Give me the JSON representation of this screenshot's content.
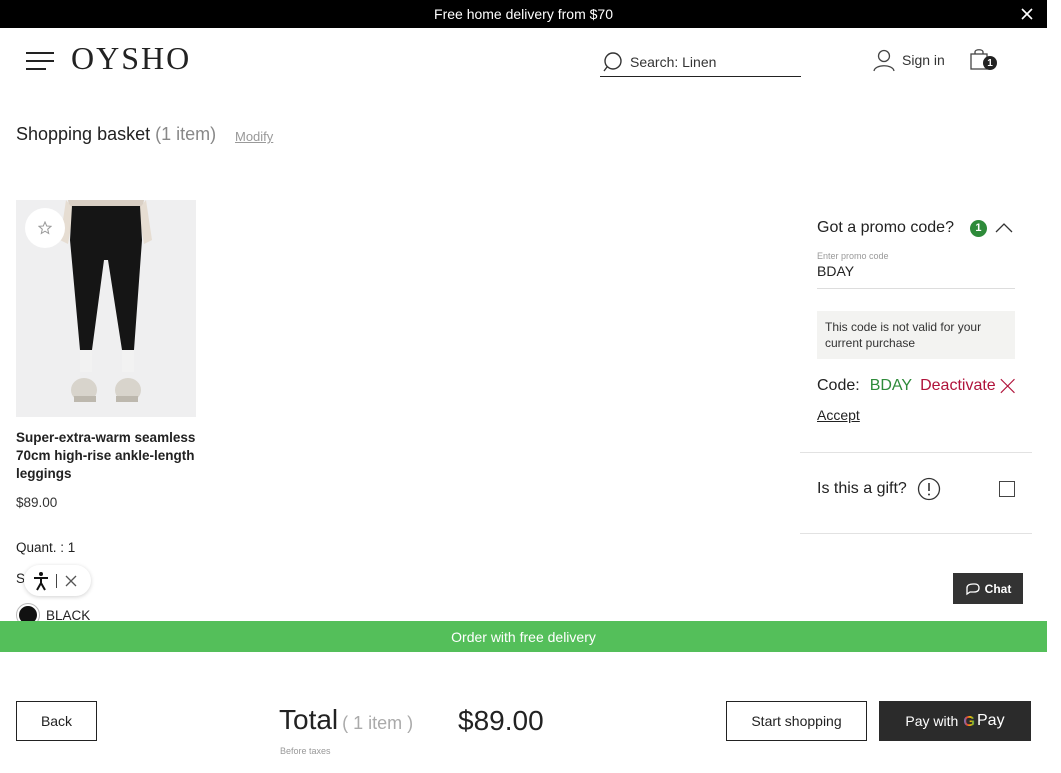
{
  "banner": {
    "text": "Free home delivery from $70"
  },
  "header": {
    "logo": "OYSHO",
    "search_text": "Search: Linen",
    "signin_label": "Sign in",
    "bag_count": "1"
  },
  "basket": {
    "title": "Shopping basket",
    "count_text": "(1 item)",
    "modify_label": "Modify"
  },
  "product": {
    "name": "Super-extra-warm seamless 70cm high-rise ankle-length leggings",
    "price": "$89.00",
    "quantity": "Quant. : 1",
    "size_label": "S",
    "color": "BLACK"
  },
  "promo": {
    "heading": "Got a promo code?",
    "badge": "1",
    "field_label": "Enter promo code",
    "field_value": "BDAY",
    "error": "This code is not valid for your current purchase",
    "code_label": "Code:",
    "code_value": "BDAY",
    "deactivate_label": "Deactivate",
    "accept_label": "Accept"
  },
  "gift": {
    "label": "Is this a gift?"
  },
  "chat": {
    "label": "Chat"
  },
  "free_delivery": {
    "text": "Order with free delivery"
  },
  "footer": {
    "back_label": "Back",
    "total_label": "Total",
    "total_items": "( 1 item )",
    "total_price": "$89.00",
    "taxes_note": "Before taxes",
    "start_shopping_label": "Start shopping",
    "gpay_prefix": "Pay with",
    "gpay_g": "G",
    "gpay_pay": "Pay"
  },
  "colors": {
    "accent_green": "#54bf5a",
    "promo_green": "#2e8b3a",
    "deactivate_red": "#b0123a"
  }
}
